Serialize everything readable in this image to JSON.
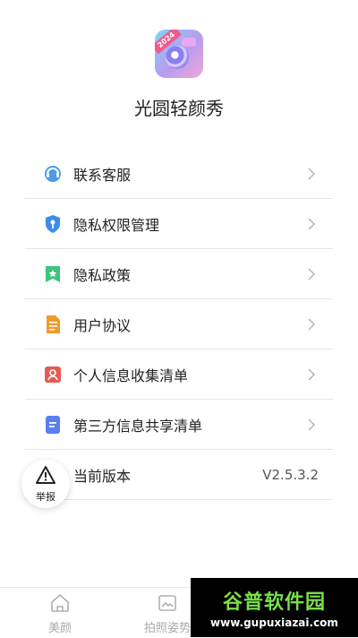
{
  "app": {
    "name": "光圆轻颜秀",
    "icon_badge": "2024"
  },
  "menu": [
    {
      "label": "联系客服",
      "icon": "customer-service-icon",
      "color": "#4a9be8"
    },
    {
      "label": "隐私权限管理",
      "icon": "shield-key-icon",
      "color": "#3d8bf0"
    },
    {
      "label": "隐私政策",
      "icon": "bookmark-star-icon",
      "color": "#3dc47e"
    },
    {
      "label": "用户协议",
      "icon": "document-icon",
      "color": "#f39a2b"
    },
    {
      "label": "个人信息收集清单",
      "icon": "person-card-icon",
      "color": "#e65a54"
    },
    {
      "label": "第三方信息共享清单",
      "icon": "list-doc-icon",
      "color": "#5a7ff0"
    },
    {
      "label": "当前版本",
      "value": "V2.5.3.2"
    }
  ],
  "report": {
    "label": "举报",
    "icon": "warning-icon"
  },
  "tabs": [
    {
      "label": "美颜",
      "icon": "home-icon"
    },
    {
      "label": "拍照姿势",
      "icon": "image-icon"
    }
  ],
  "watermark": {
    "title": "谷普软件园",
    "url": "www.gupuxiazai.com"
  }
}
